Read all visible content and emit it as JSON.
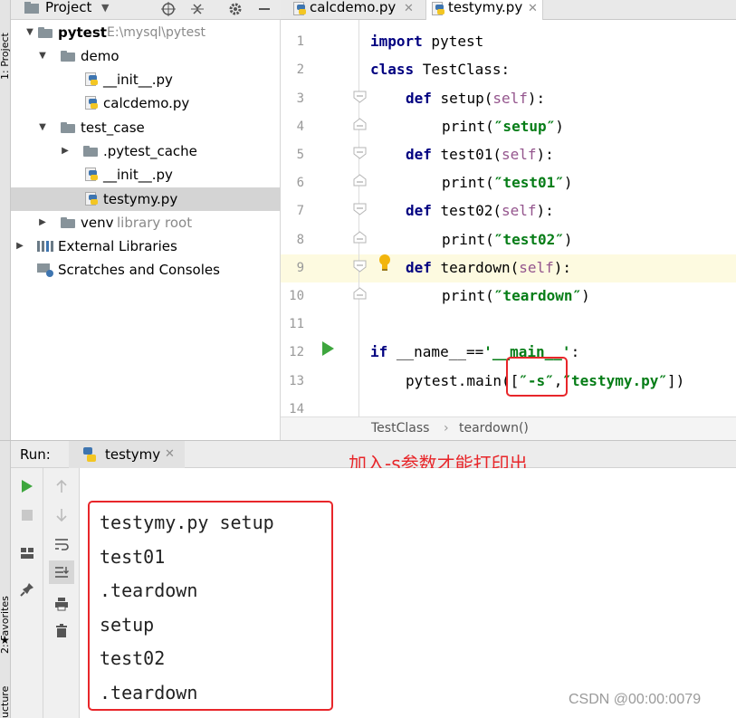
{
  "sidebar": {
    "project_label": "1: Project",
    "favorites_label": "2: Favorites",
    "structure_label": "ucture"
  },
  "project_panel": {
    "title": "Project",
    "icons": [
      "locate-icon",
      "collapse-icon",
      "gear-icon",
      "minimize-icon"
    ],
    "tree": [
      {
        "label": "pytest",
        "hint": "E:\\mysql\\pytest",
        "type": "folder",
        "expanded": true
      },
      {
        "label": "demo",
        "type": "folder",
        "expanded": true
      },
      {
        "label": "__init__.py",
        "type": "python-file"
      },
      {
        "label": "calcdemo.py",
        "type": "python-file"
      },
      {
        "label": "test_case",
        "type": "folder",
        "expanded": true
      },
      {
        "label": ".pytest_cache",
        "type": "folder",
        "expanded": false
      },
      {
        "label": "__init__.py",
        "type": "python-file"
      },
      {
        "label": "testymy.py",
        "type": "python-file",
        "selected": true
      },
      {
        "label": "venv",
        "hint": "library root",
        "type": "folder",
        "expanded": false
      },
      {
        "label": "External Libraries",
        "type": "libraries",
        "expanded": false
      },
      {
        "label": "Scratches and Consoles",
        "type": "scratches"
      }
    ]
  },
  "editor": {
    "tabs": [
      {
        "label": "calcdemo.py",
        "active": false
      },
      {
        "label": "testymy.py",
        "active": true
      }
    ],
    "line_numbers": [
      "1",
      "2",
      "3",
      "4",
      "5",
      "6",
      "7",
      "8",
      "9",
      "10",
      "11",
      "12",
      "13",
      "14"
    ],
    "code": {
      "l1_kw": "import",
      "l1_rest": " pytest",
      "l2_kw": "class",
      "l2_rest": " TestClass:",
      "l3_kw": "def",
      "l3_name": " setup(",
      "l3_self": "self",
      "l3_end": "):",
      "l4_pre": "print(",
      "l4_str": "″setup″",
      "l4_end": ")",
      "l5_kw": "def",
      "l5_name": " test01(",
      "l5_self": "self",
      "l5_end": "):",
      "l6_pre": "print(",
      "l6_str": "″test01″",
      "l6_end": ")",
      "l7_kw": "def",
      "l7_name": " test02(",
      "l7_self": "self",
      "l7_end": "):",
      "l8_pre": "print(",
      "l8_str": "″test02″",
      "l8_end": ")",
      "l9_kw": "def",
      "l9_name": " teardown(",
      "l9_self": "self",
      "l9_end": "):",
      "l10_pre": "print(",
      "l10_str": "″teardown″",
      "l10_end": ")",
      "l12_kw": "if",
      "l12_name": " __name__==",
      "l12_str": "'__main__'",
      "l12_end": ":",
      "l13_pre": "pytest.main([",
      "l13_str1": "″-s″",
      "l13_comma": ",",
      "l13_str2": "″testymy.py″",
      "l13_end": "])"
    },
    "current_line": 9,
    "run_gutter_line": 12,
    "lightbulb_line": 9,
    "breadcrumb": [
      "TestClass",
      "teardown()"
    ],
    "breadcrumb_sep": "›"
  },
  "run_panel": {
    "label": "Run:",
    "tab_label": "testymy",
    "annotation": "加入-s参数才能打印出",
    "output": [
      "testymy.py setup",
      "test01",
      ".teardown",
      "setup",
      "test02",
      ".teardown"
    ],
    "tool_icons_left": [
      "run-icon",
      "stop-icon",
      "layout-icon",
      "pin-icon"
    ],
    "tool_icons_right": [
      "up-arrow-icon",
      "down-arrow-icon",
      "soft-wrap-icon",
      "scroll-to-end-icon",
      "print-icon",
      "trash-icon"
    ]
  },
  "watermark": "CSDN @00:00:0079",
  "colors": {
    "keyword": "#000080",
    "string": "#067d17",
    "self": "#94558d",
    "highlight_box": "#e8262a",
    "current_line": "#fdfae0",
    "run_green": "#3ea63e"
  }
}
